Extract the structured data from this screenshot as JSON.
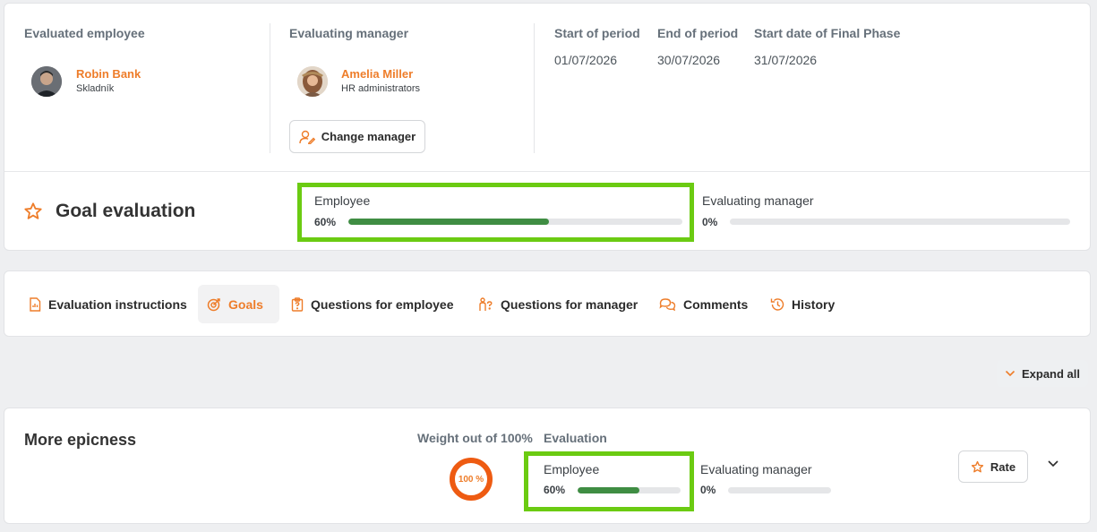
{
  "header": {
    "evaluated_label": "Evaluated employee",
    "employee_name": "Robin Bank",
    "employee_role": "Skladník",
    "manager_label": "Evaluating manager",
    "manager_name": "Amelia Miller",
    "manager_role": "HR administrators",
    "change_manager_label": "Change manager",
    "start_label": "Start of period",
    "start_value": "01/07/2026",
    "end_label": "End of period",
    "end_value": "30/07/2026",
    "final_label": "Start date of Final Phase",
    "final_value": "31/07/2026"
  },
  "summary": {
    "title": "Goal evaluation",
    "employee_label": "Employee",
    "employee_pct_text": "60%",
    "employee_progress": 60,
    "manager_label": "Evaluating manager",
    "manager_pct_text": "0%",
    "manager_progress": 0
  },
  "tabs": [
    {
      "label": "Evaluation instructions",
      "icon": "document-icon"
    },
    {
      "label": "Goals",
      "icon": "target-icon"
    },
    {
      "label": "Questions for employee",
      "icon": "clipboard-question-icon"
    },
    {
      "label": "Questions for manager",
      "icon": "person-question-icon"
    },
    {
      "label": "Comments",
      "icon": "chat-icon"
    },
    {
      "label": "History",
      "icon": "history-icon"
    }
  ],
  "active_tab": "Goals",
  "expand_all_label": "Expand all",
  "goal": {
    "name": "More epicness",
    "weight_label": "Weight out of 100%",
    "weight_value": "100 %",
    "evaluation_label": "Evaluation",
    "employee_label": "Employee",
    "employee_pct_text": "60%",
    "employee_progress": 60,
    "manager_label": "Evaluating manager",
    "manager_pct_text": "0%",
    "manager_progress": 0,
    "rate_label": "Rate"
  },
  "colors": {
    "accent": "#ee7d2a",
    "progress": "#3f8d43",
    "highlight": "#6bcb12"
  }
}
